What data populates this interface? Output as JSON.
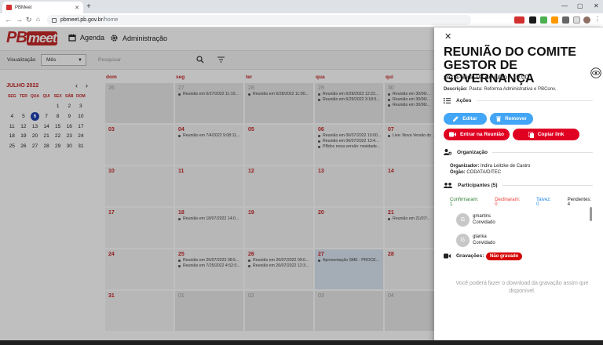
{
  "browser": {
    "tab_title": "PBMeet",
    "url_host": "pbmeet.pb.gov.br",
    "url_path": "/home"
  },
  "app": {
    "logo_pb": "PB",
    "logo_meet": "meet",
    "nav": [
      {
        "label": "Agenda",
        "icon": "calendar-icon"
      },
      {
        "label": "Administração",
        "icon": "gear-icon"
      }
    ]
  },
  "filters": {
    "view_label": "Visualização",
    "view_value": "Mês",
    "search_placeholder": "Pesquisar"
  },
  "minical": {
    "title": "JULHO 2022",
    "weekdays": [
      "SEG",
      "TER",
      "QUA",
      "QUI",
      "SEX",
      "SÁB",
      "DOM"
    ],
    "days": [
      "",
      "",
      "",
      "",
      "1",
      "2",
      "3",
      "4",
      "5",
      "6",
      "7",
      "8",
      "9",
      "10",
      "11",
      "12",
      "13",
      "14",
      "15",
      "16",
      "17",
      "18",
      "19",
      "20",
      "21",
      "22",
      "23",
      "24",
      "25",
      "26",
      "27",
      "28",
      "29",
      "30",
      "31"
    ],
    "selected": "6"
  },
  "calendar": {
    "weekdays": [
      "dom",
      "seg",
      "ter",
      "qua",
      "qui"
    ],
    "rows": [
      [
        {
          "d": "26",
          "o": true,
          "ev": []
        },
        {
          "d": "27",
          "o": true,
          "ev": [
            "Reunião em 6/27/2022 11:10..."
          ]
        },
        {
          "d": "28",
          "o": true,
          "ev": [
            "Reunião em 6/28/2022 11:00..."
          ]
        },
        {
          "d": "29",
          "o": true,
          "ev": [
            "Reunião em 6/29/2022 12:22...",
            "Reunião em 6/29/2022 3:18:5..."
          ]
        },
        {
          "d": "30",
          "o": true,
          "ev": [
            "Reunião em 30/06/...",
            "Reunião em 30/06/...",
            "Reunião em 30/06/..."
          ]
        }
      ],
      [
        {
          "d": "03",
          "ev": []
        },
        {
          "d": "04",
          "ev": [
            "Reunião em 7/4/2022 9:08:11..."
          ]
        },
        {
          "d": "05",
          "ev": []
        },
        {
          "d": "06",
          "ev": [
            "Reunião em 06/07/2022 10:00...",
            "Reunião em 06/07/2022 13:4...",
            "PBdoc nova versão: novidade..."
          ]
        },
        {
          "d": "07",
          "ev": [
            "Live: Nova Versão do ..."
          ]
        }
      ],
      [
        {
          "d": "10",
          "ev": []
        },
        {
          "d": "11",
          "ev": []
        },
        {
          "d": "12",
          "ev": []
        },
        {
          "d": "13",
          "ev": []
        },
        {
          "d": "14",
          "ev": []
        }
      ],
      [
        {
          "d": "17",
          "ev": []
        },
        {
          "d": "18",
          "ev": [
            "Reunião em 18/07/2022 14:0..."
          ]
        },
        {
          "d": "19",
          "ev": []
        },
        {
          "d": "20",
          "ev": []
        },
        {
          "d": "21",
          "ev": [
            "Reunião em 21/07/..."
          ]
        }
      ],
      [
        {
          "d": "24",
          "ev": []
        },
        {
          "d": "25",
          "ev": [
            "Reunião em 25/07/2022 08:5...",
            "Reunião em 7/25/2022 4:52:0..."
          ]
        },
        {
          "d": "26",
          "ev": [
            "Reunião em 26/07/2022 09:0...",
            "Reunião em 26/07/2022 12:3..."
          ]
        },
        {
          "d": "27",
          "h": true,
          "ev": [
            "Apresentação SME - PROCE..."
          ]
        },
        {
          "d": "28",
          "ev": []
        }
      ],
      [
        {
          "d": "31",
          "ev": []
        },
        {
          "d": "01",
          "o": true,
          "ev": []
        },
        {
          "d": "02",
          "o": true,
          "ev": []
        },
        {
          "d": "03",
          "o": true,
          "ev": []
        },
        {
          "d": "04",
          "o": true,
          "ev": []
        }
      ]
    ]
  },
  "panel": {
    "title": "REUNIÃO DO COMITE GESTOR DE GOVERNANÇA",
    "date": "sexta-feira, 08 de julho - 10:00",
    "desc_label": "Descrição:",
    "desc_value": "Pauta: Reforma Administrativa e PBConv.",
    "actions_label": "Ações",
    "edit_label": "Editar",
    "remove_label": "Remover",
    "join_label": "Entrar na Reunião",
    "copy_label": "Copiar link",
    "org_section": "Organização",
    "organizer_label": "Organizador:",
    "organizer_value": "Indira Leitzke de Castro",
    "orgao_label": "Órgão:",
    "orgao_value": "CODATA/DITEC",
    "participants_label": "Participantes (5)",
    "confirmed": "Confirmaram: 1",
    "declined": "Declinaram: 0",
    "maybe": "Talvez: 0",
    "pending": "Pendentes: 4",
    "participants": [
      {
        "initial": "G",
        "name": "gmartins",
        "role": "Convidado"
      },
      {
        "initial": "G",
        "name": "glanka",
        "role": "Convidado"
      }
    ],
    "recordings_label": "Gravações:",
    "not_recorded": "Não gravado",
    "download_msg": "Você poderá fazer o download da gravação assim que disponível."
  },
  "colors": {
    "accent_red": "#c62828",
    "blue_button": "#42a5f5",
    "red_button": "#e00021",
    "confirmed": "#2e7d32",
    "declined": "#e53935",
    "maybe": "#1e88e5"
  }
}
